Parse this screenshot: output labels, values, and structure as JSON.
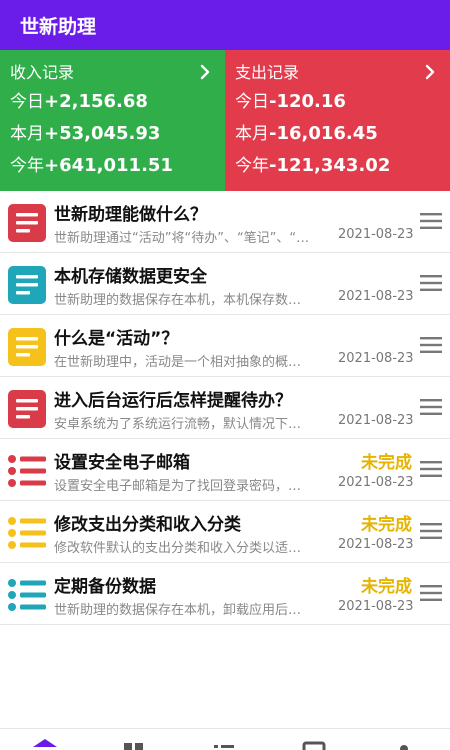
{
  "app": {
    "title": "世新助理"
  },
  "colors": {
    "appbar": "#6a1de8",
    "income": "#2fae4a",
    "expense": "#e23b4b",
    "pending": "#e6b400",
    "icon_red": "#d93b49",
    "icon_teal": "#1fa6b8",
    "icon_yellow": "#f5c21b"
  },
  "summary": {
    "income": {
      "title": "收入记录",
      "today_label": "今日",
      "today_value": "+2,156.68",
      "month_label": "本月",
      "month_value": "+53,045.93",
      "year_label": "今年",
      "year_value": "+641,011.51"
    },
    "expense": {
      "title": "支出记录",
      "today_label": "今日",
      "today_value": "-120.16",
      "month_label": "本月",
      "month_value": "-16,016.45",
      "year_label": "今年",
      "year_value": "-121,343.02"
    }
  },
  "items": [
    {
      "title": "世新助理能做什么？",
      "desc": "世新助理通过“活动”将“待办”、“笔记”、“…",
      "date": "2021-08-23",
      "status": "",
      "icon": "note-icon",
      "color": "#d93b49"
    },
    {
      "title": "本机存储数据更安全",
      "desc": "世新助理的数据保存在本机，本机保存数…",
      "date": "2021-08-23",
      "status": "",
      "icon": "note-icon",
      "color": "#1fa6b8"
    },
    {
      "title": "什么是“活动”？",
      "desc": "在世新助理中，活动是一个相对抽象的概…",
      "date": "2021-08-23",
      "status": "",
      "icon": "note-icon",
      "color": "#f5c21b"
    },
    {
      "title": "进入后台运行后怎样提醒待办？",
      "desc": "安卓系统为了系统运行流畅，默认情况下…",
      "date": "2021-08-23",
      "status": "",
      "icon": "note-icon",
      "color": "#d93b49"
    },
    {
      "title": "设置安全电子邮箱",
      "desc": "设置安全电子邮箱是为了找回登录密码，…",
      "date": "2021-08-23",
      "status": "未完成",
      "icon": "todo-list-icon",
      "color": "#d93b49"
    },
    {
      "title": "修改支出分类和收入分类",
      "desc": "修改软件默认的支出分类和收入分类以适…",
      "date": "2021-08-23",
      "status": "未完成",
      "icon": "todo-list-icon",
      "color": "#f5c21b"
    },
    {
      "title": "定期备份数据",
      "desc": "世新助理的数据保存在本机，卸载应用后…",
      "date": "2021-08-23",
      "status": "未完成",
      "icon": "todo-list-icon",
      "color": "#1fa6b8"
    }
  ],
  "bottom_nav": [
    {
      "icon": "home-icon"
    },
    {
      "icon": "grid-icon"
    },
    {
      "icon": "list-icon"
    },
    {
      "icon": "card-icon"
    },
    {
      "icon": "profile-icon"
    }
  ]
}
